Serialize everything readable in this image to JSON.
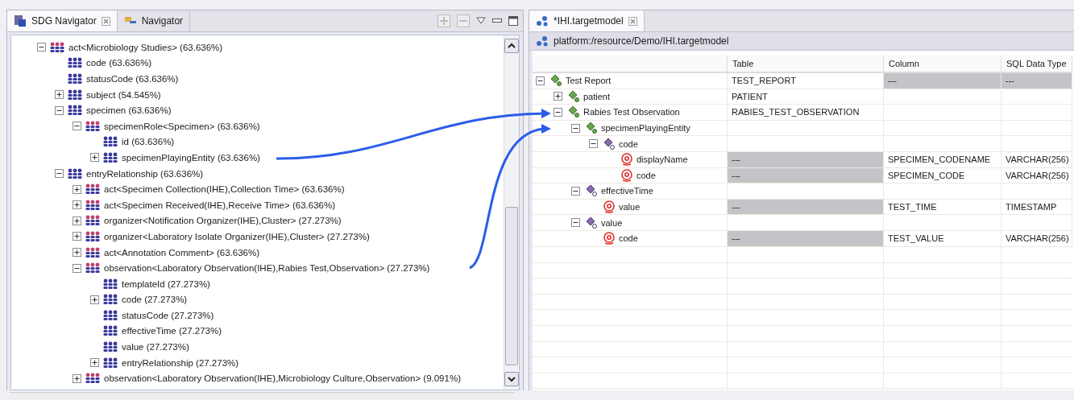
{
  "left_panel": {
    "tabs": [
      {
        "label": "SDG Navigator",
        "selected": true
      },
      {
        "label": "Navigator",
        "selected": false
      }
    ],
    "tree": [
      {
        "label": "act<Microbiology Studies> (63.636%)",
        "kind": "template",
        "expanded": true,
        "children": [
          {
            "label": "code (63.636%)",
            "kind": "element"
          },
          {
            "label": "statusCode (63.636%)",
            "kind": "element"
          },
          {
            "label": "subject (54.545%)",
            "kind": "element",
            "expanded": false
          },
          {
            "label": "specimen (63.636%)",
            "kind": "element",
            "expanded": true,
            "children": [
              {
                "label": "specimenRole<Specimen> (63.636%)",
                "kind": "template",
                "expanded": true,
                "children": [
                  {
                    "label": "id (63.636%)",
                    "kind": "element"
                  },
                  {
                    "label": "specimenPlayingEntity (63.636%)",
                    "kind": "element",
                    "expanded": false
                  }
                ]
              }
            ]
          },
          {
            "label": "entryRelationship (63.636%)",
            "kind": "element",
            "expanded": true,
            "children": [
              {
                "label": "act<Specimen Collection(IHE),Collection Time> (63.636%)",
                "kind": "template",
                "expanded": false
              },
              {
                "label": "act<Specimen Received(IHE),Receive Time> (63.636%)",
                "kind": "template",
                "expanded": false
              },
              {
                "label": "organizer<Notification Organizer(IHE),Cluster> (27.273%)",
                "kind": "template",
                "expanded": false
              },
              {
                "label": "organizer<Laboratory Isolate Organizer(IHE),Cluster> (27.273%)",
                "kind": "template",
                "expanded": false
              },
              {
                "label": "act<Annotation Comment> (63.636%)",
                "kind": "template",
                "expanded": false
              },
              {
                "label": "observation<Laboratory Observation(IHE),Rabies Test,Observation> (27.273%)",
                "kind": "template",
                "expanded": true,
                "children": [
                  {
                    "label": "templateId (27.273%)",
                    "kind": "element"
                  },
                  {
                    "label": "code (27.273%)",
                    "kind": "element",
                    "expanded": false
                  },
                  {
                    "label": "statusCode (27.273%)",
                    "kind": "element"
                  },
                  {
                    "label": "effectiveTime (27.273%)",
                    "kind": "element"
                  },
                  {
                    "label": "value (27.273%)",
                    "kind": "element"
                  },
                  {
                    "label": "entryRelationship (27.273%)",
                    "kind": "element",
                    "expanded": false
                  }
                ]
              },
              {
                "label": "observation<Laboratory Observation(IHE),Microbiology Culture,Observation> (9.091%)",
                "kind": "template",
                "expanded": false
              }
            ]
          }
        ]
      }
    ]
  },
  "right_panel": {
    "tabs": [
      {
        "label": "*IHI.targetmodel",
        "selected": true
      }
    ],
    "path": "platform:/resource/Demo/IHI.targetmodel",
    "columns": [
      "Table",
      "Column",
      "SQL Data Type"
    ],
    "tree": [
      {
        "label": "Test Report",
        "kind": "element",
        "expanded": true,
        "cells": [
          {
            "text": "TEST_REPORT",
            "shaded": false
          },
          {
            "text": "---",
            "shaded": true
          },
          {
            "text": "---",
            "shaded": true
          }
        ],
        "children": [
          {
            "label": "patient",
            "kind": "element",
            "expanded": false,
            "cells": [
              {
                "text": "PATIENT",
                "shaded": false
              },
              {
                "shaded": false
              },
              {
                "shaded": false
              }
            ]
          },
          {
            "label": "Rabies Test Observation",
            "kind": "element",
            "expanded": true,
            "cells": [
              {
                "text": "RABIES_TEST_OBSERVATION",
                "shaded": false
              },
              {
                "shaded": false
              },
              {
                "shaded": false
              }
            ],
            "children": [
              {
                "label": "specimenPlayingEntity",
                "kind": "element",
                "expanded": true,
                "cells": [
                  {
                    "shaded": false
                  },
                  {
                    "shaded": false
                  },
                  {
                    "shaded": false
                  }
                ],
                "children": [
                  {
                    "label": "code",
                    "kind": "group",
                    "expanded": true,
                    "cells": [
                      {
                        "shaded": false
                      },
                      {
                        "shaded": false
                      },
                      {
                        "shaded": false
                      }
                    ],
                    "children": [
                      {
                        "label": "displayName",
                        "kind": "attribute",
                        "cells": [
                          {
                            "text": "---",
                            "shaded": true
                          },
                          {
                            "text": "SPECIMEN_CODENAME",
                            "shaded": false
                          },
                          {
                            "text": "VARCHAR(256)",
                            "shaded": false
                          }
                        ]
                      },
                      {
                        "label": "code",
                        "kind": "attribute",
                        "cells": [
                          {
                            "text": "---",
                            "shaded": true
                          },
                          {
                            "text": "SPECIMEN_CODE",
                            "shaded": false
                          },
                          {
                            "text": "VARCHAR(256)",
                            "shaded": false
                          }
                        ]
                      }
                    ]
                  }
                ]
              },
              {
                "label": "effectiveTime",
                "kind": "group",
                "expanded": true,
                "cells": [
                  {
                    "shaded": false
                  },
                  {
                    "shaded": false
                  },
                  {
                    "shaded": false
                  }
                ],
                "children": [
                  {
                    "label": "value",
                    "kind": "attribute",
                    "cells": [
                      {
                        "text": "---",
                        "shaded": true
                      },
                      {
                        "text": "TEST_TIME",
                        "shaded": false
                      },
                      {
                        "text": "TIMESTAMP",
                        "shaded": false
                      }
                    ]
                  }
                ]
              },
              {
                "label": "value",
                "kind": "group",
                "expanded": true,
                "cells": [
                  {
                    "shaded": false
                  },
                  {
                    "shaded": false
                  },
                  {
                    "shaded": false
                  }
                ],
                "children": [
                  {
                    "label": "code",
                    "kind": "attribute",
                    "cells": [
                      {
                        "text": "---",
                        "shaded": true
                      },
                      {
                        "text": "TEST_VALUE",
                        "shaded": false
                      },
                      {
                        "text": "VARCHAR(256)",
                        "shaded": false
                      }
                    ]
                  }
                ]
              }
            ]
          }
        ]
      }
    ]
  }
}
